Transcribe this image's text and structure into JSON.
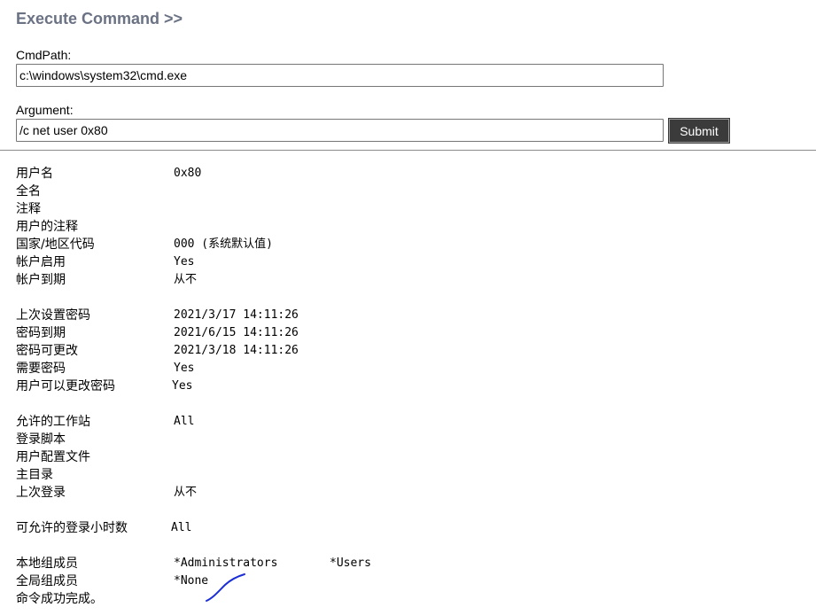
{
  "header": {
    "title": "Execute Command >>"
  },
  "form": {
    "cmd_path_label": "CmdPath:",
    "cmd_path_value": "c:\\windows\\system32\\cmd.exe",
    "argument_label": "Argument:",
    "argument_value": "/c net user 0x80",
    "submit_label": "Submit"
  },
  "output": {
    "lines": [
      {
        "label": "用户名",
        "value": "0x80",
        "value2": ""
      },
      {
        "label": "全名",
        "value": "",
        "value2": ""
      },
      {
        "label": "注释",
        "value": "",
        "value2": ""
      },
      {
        "label": "用户的注释",
        "value": "",
        "value2": ""
      },
      {
        "label": "国家/地区代码",
        "value": "000 (系统默认值)",
        "value2": ""
      },
      {
        "label": "帐户启用",
        "value": "Yes",
        "value2": ""
      },
      {
        "label": "帐户到期",
        "value": "从不",
        "value2": ""
      },
      {
        "label": "",
        "value": "",
        "value2": ""
      },
      {
        "label": "上次设置密码",
        "value": "2021/3/17 14:11:26",
        "value2": ""
      },
      {
        "label": "密码到期",
        "value": "2021/6/15 14:11:26",
        "value2": ""
      },
      {
        "label": "密码可更改",
        "value": "2021/3/18 14:11:26",
        "value2": ""
      },
      {
        "label": "需要密码",
        "value": "Yes",
        "value2": ""
      },
      {
        "label": "用户可以更改密码",
        "value": "Yes",
        "value2": ""
      },
      {
        "label": "",
        "value": "",
        "value2": ""
      },
      {
        "label": "允许的工作站",
        "value": "All",
        "value2": ""
      },
      {
        "label": "登录脚本",
        "value": "",
        "value2": ""
      },
      {
        "label": "用户配置文件",
        "value": "",
        "value2": ""
      },
      {
        "label": "主目录",
        "value": "",
        "value2": ""
      },
      {
        "label": "上次登录",
        "value": "从不",
        "value2": ""
      },
      {
        "label": "",
        "value": "",
        "value2": ""
      },
      {
        "label": "可允许的登录小时数",
        "value": "All",
        "value2": ""
      },
      {
        "label": "",
        "value": "",
        "value2": ""
      },
      {
        "label": "本地组成员",
        "value": "*Administrators",
        "value2": "*Users"
      },
      {
        "label": "全局组成员",
        "value": "*None",
        "value2": ""
      },
      {
        "label": "命令成功完成。",
        "value": "",
        "value2": ""
      }
    ]
  },
  "colors": {
    "title": "#6a7284",
    "button_bg": "#3b3b3b",
    "annotation_stroke": "#1c2fd6"
  }
}
